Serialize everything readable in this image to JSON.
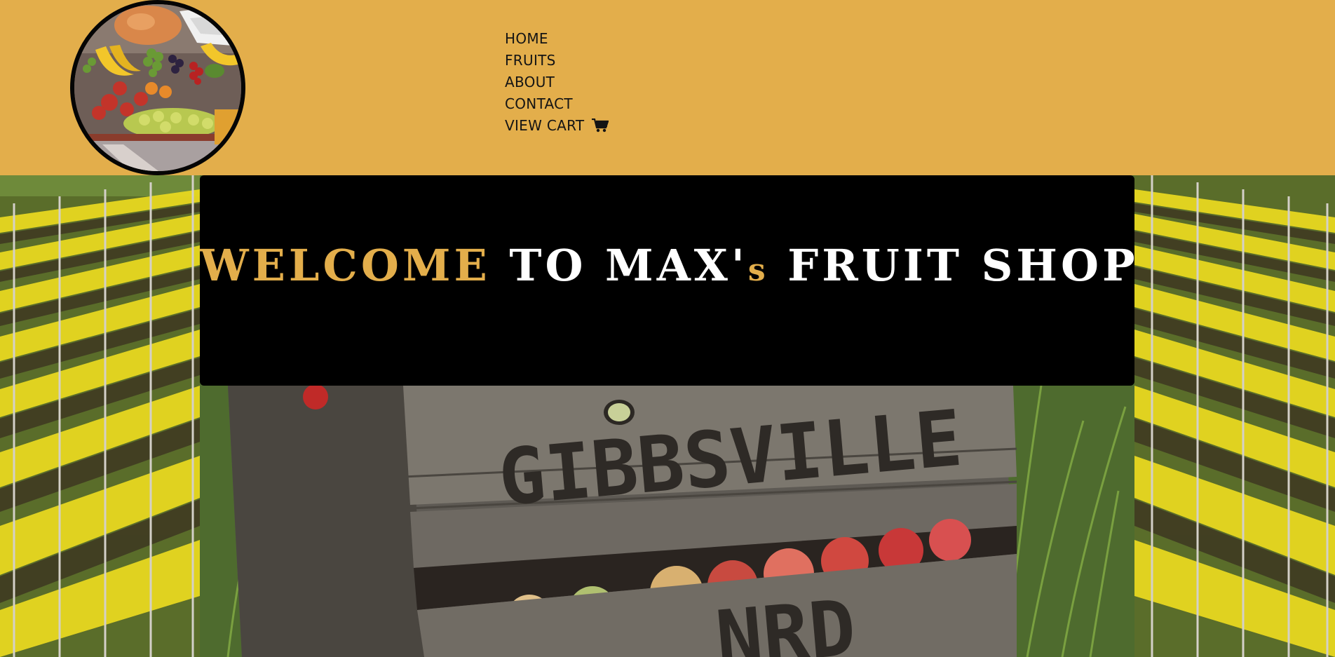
{
  "colors": {
    "header_bg": "#E3AE4B",
    "accent": "#E3AE4B",
    "banner_bg": "#000000",
    "nav_text": "#141414"
  },
  "logo": {
    "icon": "fruit-stand-logo"
  },
  "nav": {
    "items": [
      {
        "label": "HOME"
      },
      {
        "label": "FRUITS"
      },
      {
        "label": "ABOUT"
      },
      {
        "label": "CONTACT"
      },
      {
        "label": "VIEW CART",
        "icon": "shopping-cart-icon"
      }
    ]
  },
  "banner": {
    "word1": "WELCOME",
    "word2": "TO MAX'",
    "word3": "s",
    "word4": "FRUIT SHOP"
  },
  "crate": {
    "stencil_top": "GIBBSVILLE",
    "stencil_bottom": "NRD"
  }
}
